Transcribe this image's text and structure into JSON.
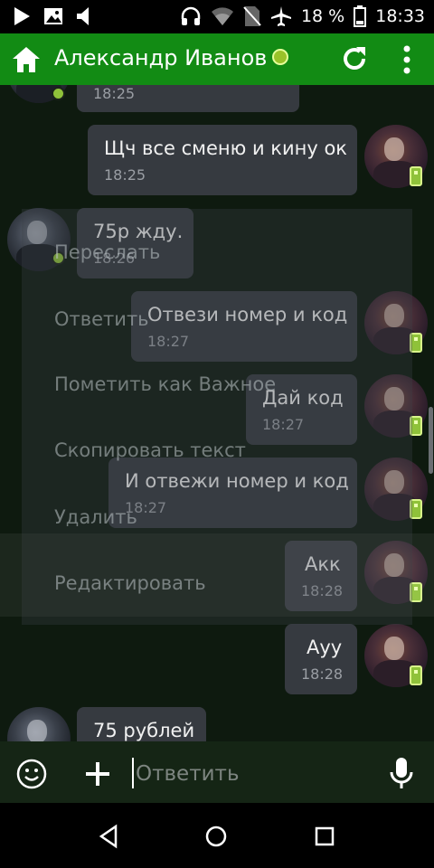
{
  "status_bar": {
    "battery_text": "18 %",
    "time": "18:33"
  },
  "toolbar": {
    "title": "Александр Иванов"
  },
  "messages": [
    {
      "side": "in",
      "text": "",
      "time": "18:25"
    },
    {
      "side": "out",
      "text": "Щч все сменю и кину ок",
      "time": "18:25"
    },
    {
      "side": "in",
      "text": "75р жду.",
      "time": "18:26"
    },
    {
      "side": "out",
      "text": "Отвези номер и код",
      "time": "18:27"
    },
    {
      "side": "out",
      "text": "Дай код",
      "time": "18:27"
    },
    {
      "side": "out",
      "text": "И отвежи номер и код",
      "time": "18:27"
    },
    {
      "side": "out",
      "text": "Акк",
      "time": "18:28"
    },
    {
      "side": "out",
      "text": "Ауу",
      "time": "18:28"
    },
    {
      "side": "in",
      "text": "75 рублей",
      "time": ""
    }
  ],
  "context_menu": {
    "items": [
      "Переслать",
      "Ответить",
      "Пометить как Важное",
      "Скопировать текст",
      "Удалить",
      "Редактировать"
    ]
  },
  "composer": {
    "placeholder": "Ответить"
  },
  "colors": {
    "toolbar": "#128b14",
    "bubble": "#363a40",
    "online": "#8fc23a"
  }
}
